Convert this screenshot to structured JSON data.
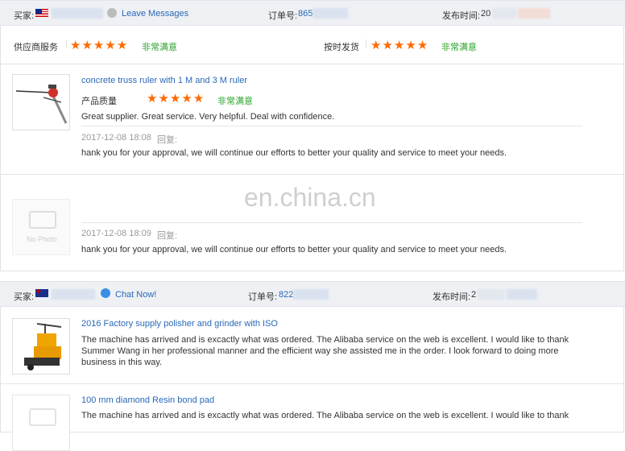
{
  "order1": {
    "buyer_label": "买家:",
    "leave_messages": "Leave Messages",
    "order_label": "订单号:",
    "order_no_partial": "865",
    "date_label": "发布时间:",
    "date_partial": "20"
  },
  "ratings": {
    "supplier_service_label": "供应商服务",
    "supplier_service_text": "非常满意",
    "supplier_service_stars": 5,
    "on_time_label": "按时发货",
    "on_time_text": "非常满意",
    "on_time_stars": 5
  },
  "review1": {
    "product_title": "concrete truss ruler with 1 M and 3 M ruler",
    "quality_label": "产品质量",
    "quality_text": "非常满意",
    "quality_stars": 5,
    "comment": "Great supplier. Great service. Very helpful. Deal with confidence.",
    "reply_time": "2017-12-08 18:08",
    "reply_label": "回复:",
    "reply_text": "hank you for your approval, we will continue our efforts to better your quality and service to meet your needs."
  },
  "review2": {
    "no_photo": "No Photo",
    "watermark": "en.china.cn",
    "reply_time": "2017-12-08 18:09",
    "reply_label": "回复:",
    "reply_text": "hank you for your approval, we will continue our efforts to better your quality and service to meet your needs."
  },
  "order2": {
    "buyer_label": "买家:",
    "chat_now": "Chat Now!",
    "order_label": "订单号:",
    "order_no_partial": "822",
    "date_label": "发布时间:",
    "date_partial": "2"
  },
  "review3": {
    "product_title": "2016 Factory supply polisher and grinder with ISO",
    "comment": "The machine has arrived and is excactly what was ordered. The Alibaba service on the web is excellent. I would like to thank Summer Wang in her professional manner and the efficient way she assisted me in the order. I look forward to doing more business in this way."
  },
  "review4": {
    "product_title": "100 mm diamond Resin bond pad",
    "comment_partial": "The machine has arrived and is excactly what was ordered. The Alibaba service on the web is excellent. I would like to thank"
  },
  "colors": {
    "link": "#2a69b8",
    "star": "#ff6a00",
    "satisfied_green": "#29a329",
    "header_bg": "#eef0f4"
  }
}
